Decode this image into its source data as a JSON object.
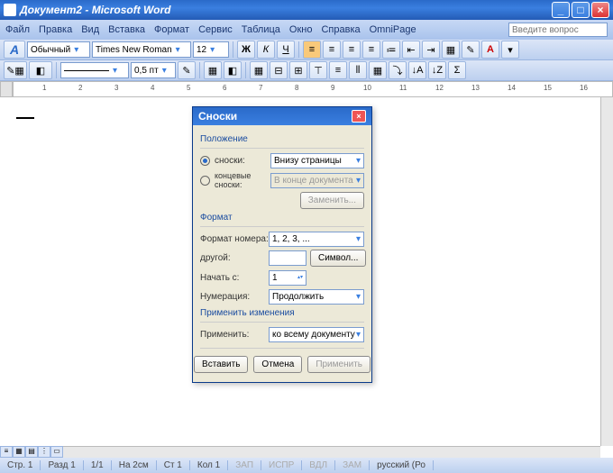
{
  "window_title": "Документ2 - Microsoft Word",
  "menu": [
    "Файл",
    "Правка",
    "Вид",
    "Вставка",
    "Формат",
    "Сервис",
    "Таблица",
    "Окно",
    "Справка",
    "OmniPage"
  ],
  "help_placeholder": "Введите вопрос",
  "fmt": {
    "style": "Обычный",
    "font": "Times New Roman",
    "size": "12"
  },
  "line_width": "0,5 пт",
  "ruler_marks": [
    "1",
    "2",
    "3",
    "4",
    "5",
    "6",
    "7",
    "8",
    "9",
    "10",
    "11",
    "12",
    "13",
    "14",
    "15",
    "16"
  ],
  "status": {
    "page": "Стр. 1",
    "section": "Разд 1",
    "pages": "1/1",
    "pos": "На 2см",
    "line": "Ст 1",
    "col": "Кол 1",
    "rec": "ЗАП",
    "trk": "ИСПР",
    "ext": "ВДЛ",
    "ovr": "ЗАМ",
    "lang": "русский (Ро"
  },
  "dialog": {
    "title": "Сноски",
    "grp_position": "Положение",
    "radio_footnotes": "сноски:",
    "footnotes_loc": "Внизу страницы",
    "radio_endnotes": "концевые сноски:",
    "endnotes_loc": "В конце документа",
    "btn_change": "Заменить...",
    "grp_format": "Формат",
    "lbl_numfmt": "Формат номера:",
    "numfmt": "1, 2, 3, ...",
    "lbl_custom": "другой:",
    "btn_symbol": "Символ...",
    "lbl_start": "Начать с:",
    "start_val": "1",
    "lbl_numbering": "Нумерация:",
    "numbering": "Продолжить",
    "grp_apply": "Применить изменения",
    "lbl_applyto": "Применить:",
    "applyto": "ко всему документу",
    "btn_insert": "Вставить",
    "btn_cancel": "Отмена",
    "btn_apply": "Применить"
  }
}
